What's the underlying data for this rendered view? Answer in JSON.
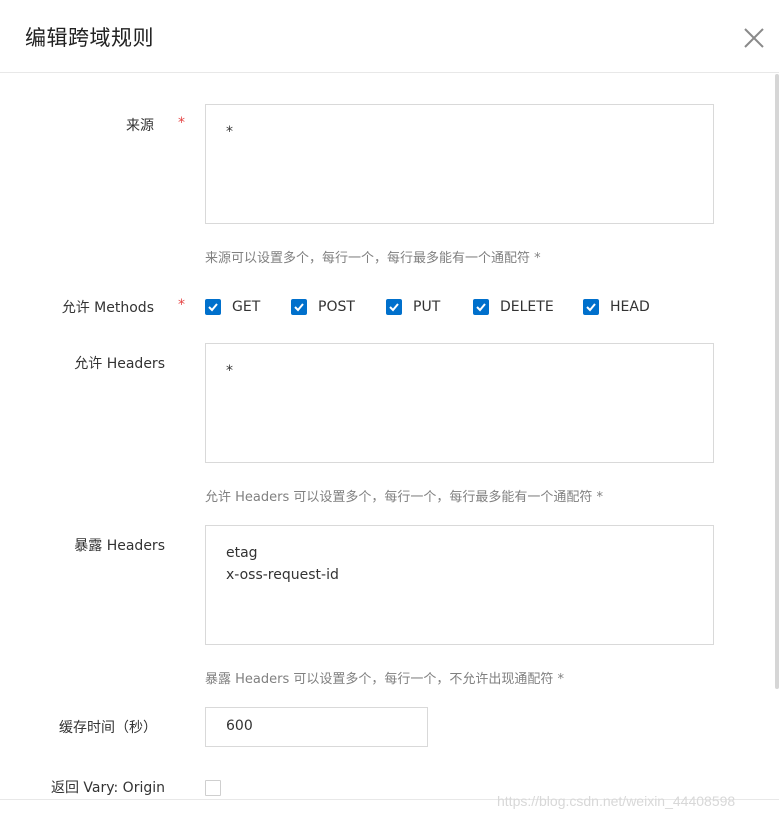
{
  "dialog": {
    "title": "编辑跨域规则"
  },
  "form": {
    "origin": {
      "label": "来源",
      "required_mark": "*",
      "value_lines": [
        "*"
      ],
      "hint": "来源可以设置多个，每行一个，每行最多能有一个通配符 *"
    },
    "methods": {
      "label": "允许 Methods",
      "required_mark": "*",
      "options": [
        {
          "label": "GET",
          "checked": true
        },
        {
          "label": "POST",
          "checked": true
        },
        {
          "label": "PUT",
          "checked": true
        },
        {
          "label": "DELETE",
          "checked": true
        },
        {
          "label": "HEAD",
          "checked": true
        }
      ]
    },
    "allow_headers": {
      "label": "允许 Headers",
      "value_lines": [
        "*"
      ],
      "hint": "允许 Headers 可以设置多个，每行一个，每行最多能有一个通配符 *"
    },
    "expose_headers": {
      "label": "暴露 Headers",
      "value_lines": [
        "etag",
        "x-oss-request-id"
      ],
      "hint": "暴露 Headers 可以设置多个，每行一个，不允许出现通配符 *"
    },
    "cache_time": {
      "label": "缓存时间（秒）",
      "value": "600"
    },
    "vary_origin": {
      "label": "返回 Vary: Origin",
      "checked": false
    }
  },
  "watermark": "https://blog.csdn.net/weixin_44408598",
  "colors": {
    "accent": "#0070cc",
    "required": "#e54545",
    "hint": "#808080",
    "border": "#d9d9d9"
  },
  "icons": {
    "close": "close-icon",
    "check": "check-icon"
  }
}
